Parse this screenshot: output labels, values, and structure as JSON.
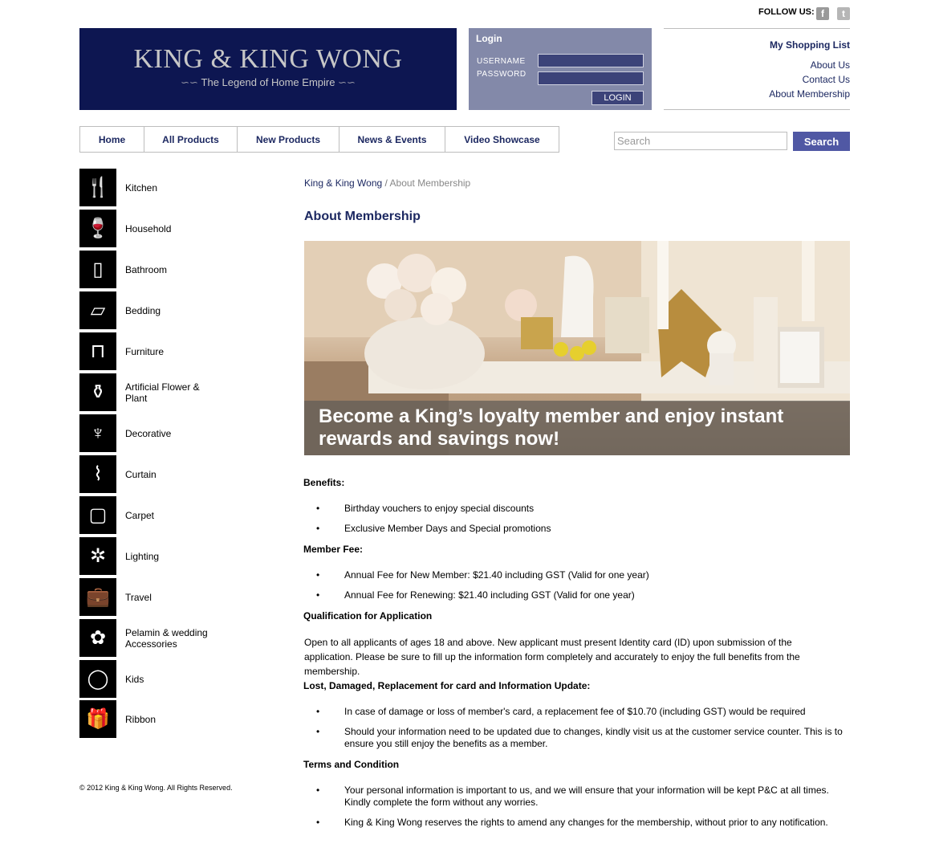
{
  "header": {
    "follow_label": "FOLLOW US:",
    "facebook_icon": "facebook-icon",
    "twitter_icon": "twitter-icon",
    "logo_title": "KING & KING WONG",
    "logo_tagline": "The Legend of Home Empire"
  },
  "login": {
    "title": "Login",
    "username_label": "USERNAME",
    "password_label": "PASSWORD",
    "button": "LOGIN"
  },
  "rightlinks": {
    "shopping_list": "My Shopping List",
    "about": "About Us",
    "contact": "Contact Us",
    "membership": "About Membership"
  },
  "nav": {
    "items": [
      "Home",
      "All Products",
      "New Products",
      "News & Events",
      "Video Showcase"
    ]
  },
  "search": {
    "placeholder": "Search",
    "button": "Search"
  },
  "sidebar": {
    "items": [
      {
        "label": "Kitchen",
        "icon": "cutlery-icon"
      },
      {
        "label": "Household",
        "icon": "glassware-icon"
      },
      {
        "label": "Bathroom",
        "icon": "towel-icon"
      },
      {
        "label": "Bedding",
        "icon": "bed-icon"
      },
      {
        "label": "Furniture",
        "icon": "armchair-icon"
      },
      {
        "label": "Artificial Flower & Plant",
        "icon": "vase-icon"
      },
      {
        "label": "Decorative",
        "icon": "candelabra-icon"
      },
      {
        "label": "Curtain",
        "icon": "curtain-icon"
      },
      {
        "label": "Carpet",
        "icon": "carpet-icon"
      },
      {
        "label": "Lighting",
        "icon": "chandelier-icon"
      },
      {
        "label": "Travel",
        "icon": "suitcase-icon"
      },
      {
        "label": "Pelamin & wedding Accessories",
        "icon": "flower-tree-icon"
      },
      {
        "label": "Kids",
        "icon": "balloon-icon"
      },
      {
        "label": "Ribbon",
        "icon": "gift-icon"
      }
    ],
    "copyright": "© 2012 King & King Wong. All Rights Reserved."
  },
  "main": {
    "breadcrumb_home": "King & King Wong",
    "breadcrumb_sep": " / ",
    "breadcrumb_current": "About Membership",
    "title": "About Membership",
    "banner_caption": "Become a King’s loyalty member and enjoy instant rewards and savings now!",
    "benefits_heading": "Benefits:",
    "benefits": [
      "Birthday vouchers to enjoy special discounts",
      "Exclusive Member Days and Special promotions"
    ],
    "fee_heading": "Member Fee:",
    "fees": [
      "Annual Fee for New Member: $21.40 including GST (Valid for one year)",
      "Annual Fee for Renewing: $21.40 including GST (Valid for one year)"
    ],
    "qualification_heading": "Qualification for Application",
    "qualification_text": "Open to all applicants of ages 18 and above. New applicant must present Identity card (ID) upon submission of the application. Please be sure to fill up the information form completely and accurately to enjoy the full benefits from the membership.",
    "lost_heading": "Lost, Damaged, Replacement for card and Information Update:",
    "lost": [
      "In case of damage or loss of member's card, a replacement fee of $10.70 (including GST) would be required",
      "Should your information need to be updated due to changes, kindly visit us at the customer service counter. This is to ensure you still enjoy the benefits as a member."
    ],
    "terms_heading": "Terms and Condition",
    "terms": [
      "Your personal information is important to us, and we will ensure that your information will be kept P&C at all times. Kindly complete the form without any worries.",
      "King & King Wong reserves the rights to amend any changes for the membership, without prior to any notification."
    ],
    "bullet": "•"
  }
}
